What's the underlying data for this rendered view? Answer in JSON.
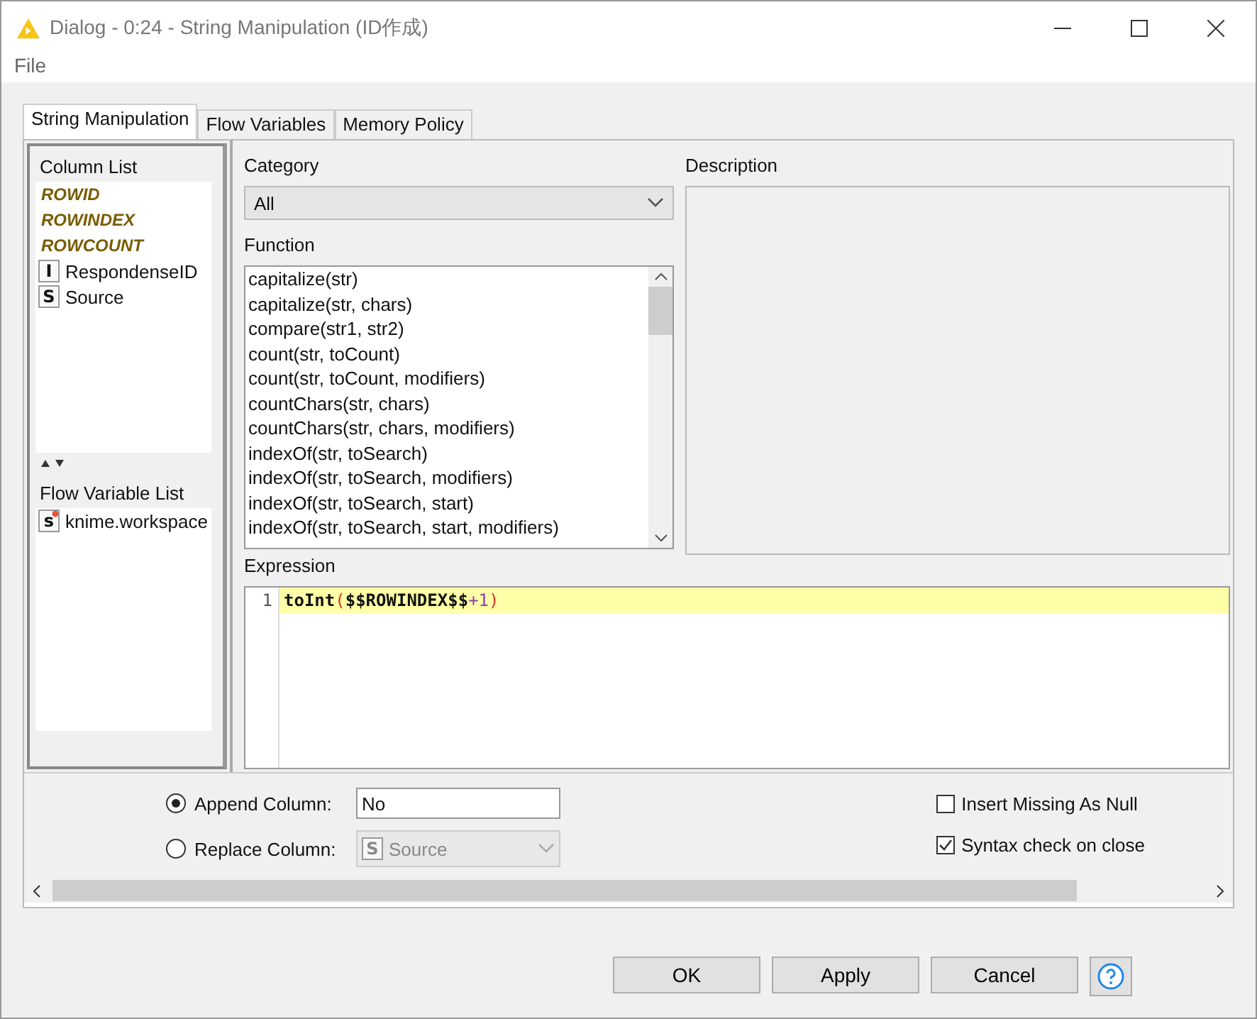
{
  "window": {
    "title": "Dialog - 0:24 - String Manipulation (ID作成)"
  },
  "menu": [
    "File"
  ],
  "tabs": [
    {
      "label": "String Manipulation",
      "selected": true
    },
    {
      "label": "Flow Variables",
      "selected": false
    },
    {
      "label": "Memory Policy",
      "selected": false
    }
  ],
  "column_list": {
    "title": "Column List",
    "items": [
      {
        "kind": "special",
        "label": "ROWID"
      },
      {
        "kind": "special",
        "label": "ROWINDEX"
      },
      {
        "kind": "special",
        "label": "ROWCOUNT"
      },
      {
        "kind": "column",
        "type": "I",
        "label": "RespondenseID"
      },
      {
        "kind": "column",
        "type": "S",
        "label": "Source"
      }
    ]
  },
  "flow_variable_list": {
    "title": "Flow Variable List",
    "items": [
      {
        "type": "s",
        "label": "knime.workspace"
      }
    ]
  },
  "category": {
    "label": "Category",
    "value": "All"
  },
  "function": {
    "label": "Function",
    "items": [
      "capitalize(str)",
      "capitalize(str, chars)",
      "compare(str1, str2)",
      "count(str, toCount)",
      "count(str, toCount, modifiers)",
      "countChars(str, chars)",
      "countChars(str, chars, modifiers)",
      "indexOf(str, toSearch)",
      "indexOf(str, toSearch, modifiers)",
      "indexOf(str, toSearch, start)",
      "indexOf(str, toSearch, start, modifiers)"
    ]
  },
  "description": {
    "label": "Description"
  },
  "expression": {
    "label": "Expression",
    "line_number": "1",
    "tokens": [
      {
        "kind": "name",
        "text": "toInt"
      },
      {
        "kind": "paren",
        "text": "("
      },
      {
        "kind": "name",
        "text": "$$ROWINDEX$$"
      },
      {
        "kind": "number",
        "text": "+1"
      },
      {
        "kind": "paren",
        "text": ")"
      }
    ]
  },
  "options": [
    {
      "label": "Append Column:",
      "selected": true,
      "value": "No",
      "kind": "text"
    },
    {
      "label": "Replace Column:",
      "selected": false,
      "value": "Source",
      "kind": "dropdown",
      "type": "S"
    }
  ],
  "checkboxes": [
    {
      "label": "Insert Missing As Null",
      "checked": false
    },
    {
      "label": "Syntax check on close",
      "checked": true
    }
  ],
  "buttons": [
    "OK",
    "Apply",
    "Cancel"
  ]
}
